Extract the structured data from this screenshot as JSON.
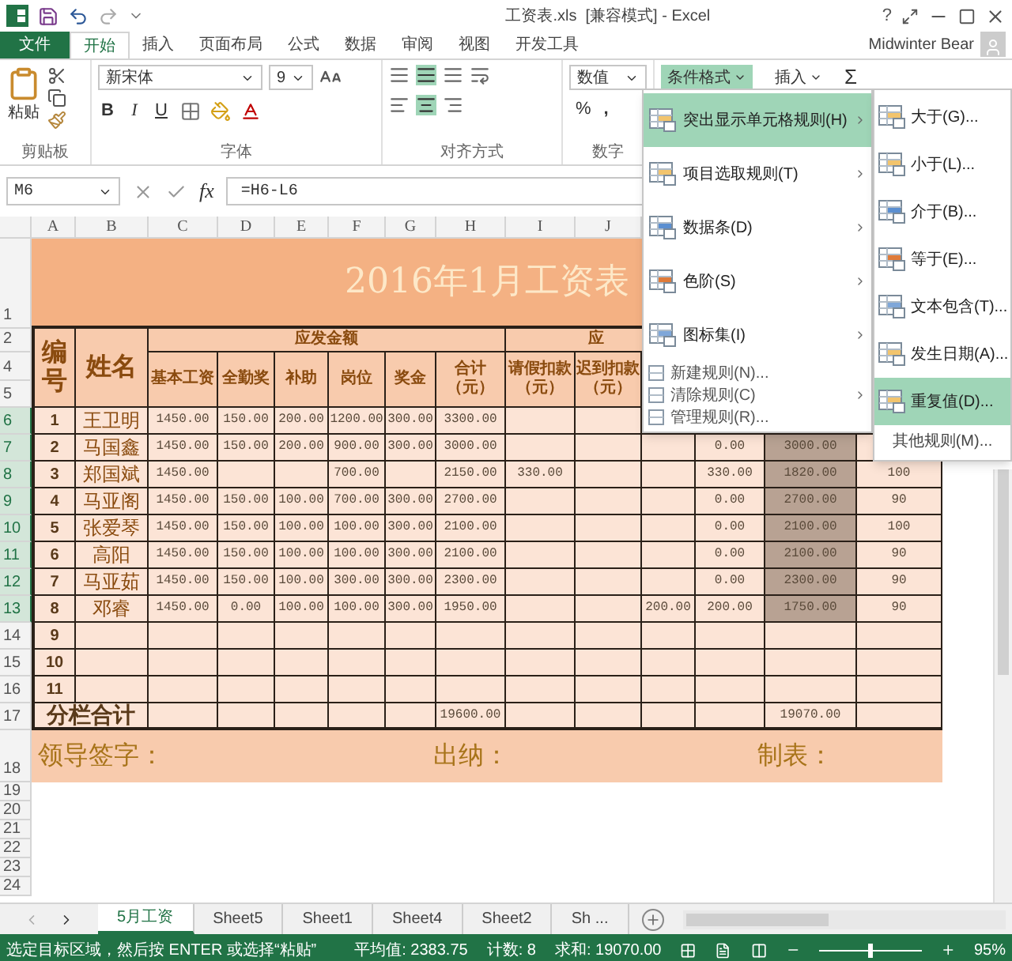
{
  "title_bar": {
    "title": "工资表.xls  [兼容模式] - Excel",
    "help": "?",
    "user": "Midwinter Bear"
  },
  "ribbon_tabs": [
    {
      "label": "文件",
      "kind": "file",
      "selected": false
    },
    {
      "label": "开始",
      "kind": "tab",
      "selected": true
    },
    {
      "label": "插入",
      "kind": "tab",
      "selected": false
    },
    {
      "label": "页面布局",
      "kind": "tab",
      "selected": false
    },
    {
      "label": "公式",
      "kind": "tab",
      "selected": false
    },
    {
      "label": "数据",
      "kind": "tab",
      "selected": false
    },
    {
      "label": "审阅",
      "kind": "tab",
      "selected": false
    },
    {
      "label": "视图",
      "kind": "tab",
      "selected": false
    },
    {
      "label": "开发工具",
      "kind": "tab",
      "selected": false
    }
  ],
  "ribbon": {
    "paste": "粘贴",
    "font_name": "新宋体",
    "font_size": "9",
    "bold": "B",
    "italic": "I",
    "underline": "U",
    "number_format": "数值",
    "percent": "%",
    "comma": ",",
    "groups": [
      "剪贴板",
      "字体",
      "对齐方式",
      "数字"
    ],
    "commands": [
      {
        "label": "条件格式",
        "active": true
      },
      {
        "label": "插入",
        "active": false
      }
    ],
    "sum": "Σ"
  },
  "formula_bar": {
    "name_box": "M6",
    "fx": "fx",
    "formula": "=H6-L6"
  },
  "sheet": {
    "columns": [
      {
        "label": "A"
      },
      {
        "label": "B"
      },
      {
        "label": "C"
      },
      {
        "label": "D"
      },
      {
        "label": "E"
      },
      {
        "label": "F"
      },
      {
        "label": "G"
      },
      {
        "label": "H"
      },
      {
        "label": "I"
      },
      {
        "label": "J"
      }
    ],
    "header_row_numbers": [
      "1",
      "2",
      "4",
      "5"
    ],
    "title": "2016年1月工资表",
    "headers": {
      "number": "编号",
      "name": "姓名",
      "gross_group": "应发金额",
      "deduct_group": "应",
      "gross_columns": [
        "基本工资",
        "全勤奖",
        "补助",
        "岗位",
        "奖金",
        "合计（元）"
      ],
      "deduct_columns": [
        "请假扣款（元）",
        "迟到扣款（元）"
      ]
    },
    "rows": [
      {
        "row": "6",
        "selected": true,
        "no": "1",
        "name": "王卫明",
        "cells": {
          "C": "1450.00",
          "D": "150.00",
          "E": "200.00",
          "F": "1200.00",
          "G": "300.00",
          "H": "3300.00"
        }
      },
      {
        "row": "7",
        "selected": true,
        "no": "2",
        "name": "马国鑫",
        "cells": {
          "C": "1450.00",
          "D": "150.00",
          "E": "200.00",
          "F": "900.00",
          "G": "300.00",
          "H": "3000.00",
          "L": "0.00",
          "M": "3000.00"
        }
      },
      {
        "row": "8",
        "selected": true,
        "no": "3",
        "name": "郑国斌",
        "cells": {
          "C": "1450.00",
          "F": "700.00",
          "H": "2150.00",
          "I": "330.00",
          "L": "330.00",
          "M": "1820.00",
          "N": "100"
        }
      },
      {
        "row": "9",
        "selected": true,
        "no": "4",
        "name": "马亚阁",
        "cells": {
          "C": "1450.00",
          "D": "150.00",
          "E": "100.00",
          "F": "700.00",
          "G": "300.00",
          "H": "2700.00",
          "L": "0.00",
          "M": "2700.00",
          "N": "90"
        }
      },
      {
        "row": "10",
        "selected": true,
        "no": "5",
        "name": "张爱琴",
        "cells": {
          "C": "1450.00",
          "D": "150.00",
          "E": "100.00",
          "F": "100.00",
          "G": "300.00",
          "H": "2100.00",
          "L": "0.00",
          "M": "2100.00",
          "N": "100"
        }
      },
      {
        "row": "11",
        "selected": true,
        "no": "6",
        "name": "高阳",
        "cells": {
          "C": "1450.00",
          "D": "150.00",
          "E": "100.00",
          "F": "100.00",
          "G": "300.00",
          "H": "2100.00",
          "L": "0.00",
          "M": "2100.00",
          "N": "90"
        }
      },
      {
        "row": "12",
        "selected": true,
        "no": "7",
        "name": "马亚茹",
        "cells": {
          "C": "1450.00",
          "D": "150.00",
          "E": "100.00",
          "F": "300.00",
          "G": "300.00",
          "H": "2300.00",
          "L": "0.00",
          "M": "2300.00",
          "N": "90"
        }
      },
      {
        "row": "13",
        "selected": true,
        "no": "8",
        "name": "邓睿",
        "cells": {
          "C": "1450.00",
          "D": "0.00",
          "E": "100.00",
          "F": "100.00",
          "G": "300.00",
          "H": "1950.00",
          "K": "200.00",
          "L": "200.00",
          "M": "1750.00",
          "N": "90"
        }
      },
      {
        "row": "14",
        "selected": false,
        "no": "9"
      },
      {
        "row": "15",
        "selected": false,
        "no": "10"
      },
      {
        "row": "16",
        "selected": false,
        "no": "11"
      }
    ],
    "total": {
      "row": "17",
      "label": "分栏合计",
      "cells": {
        "H": "19600.00",
        "M": "19070.00"
      }
    },
    "signatures": {
      "row": "18",
      "items": [
        "领导签字：",
        "出纳：",
        "制表："
      ]
    },
    "blank_rows": [
      "19",
      "20",
      "21",
      "22",
      "23",
      "24"
    ]
  },
  "menu": {
    "items": [
      {
        "label": "突出显示单元格规则(H)",
        "kind": "large",
        "selected": true,
        "submenu": true
      },
      {
        "label": "项目选取规则(T)",
        "kind": "large",
        "selected": false,
        "submenu": true
      },
      {
        "label": "数据条(D)",
        "kind": "large",
        "selected": false,
        "submenu": true
      },
      {
        "label": "色阶(S)",
        "kind": "large",
        "selected": false,
        "submenu": true
      },
      {
        "label": "图标集(I)",
        "kind": "large",
        "selected": false,
        "submenu": true
      },
      {
        "label": "新建规则(N)...",
        "kind": "small",
        "selected": false,
        "submenu": false
      },
      {
        "label": "清除规则(C)",
        "kind": "small",
        "selected": false,
        "submenu": true
      },
      {
        "label": "管理规则(R)...",
        "kind": "small",
        "selected": false,
        "submenu": false
      }
    ]
  },
  "submenu": {
    "items": [
      {
        "label": "大于(G)...",
        "kind": "large",
        "selected": false
      },
      {
        "label": "小于(L)...",
        "kind": "large",
        "selected": false
      },
      {
        "label": "介于(B)...",
        "kind": "large",
        "selected": false
      },
      {
        "label": "等于(E)...",
        "kind": "large",
        "selected": false
      },
      {
        "label": "文本包含(T)...",
        "kind": "large",
        "selected": false
      },
      {
        "label": "发生日期(A)...",
        "kind": "large",
        "selected": false
      },
      {
        "label": "重复值(D)...",
        "kind": "large",
        "selected": true
      },
      {
        "label": "其他规则(M)...",
        "kind": "text",
        "selected": false
      }
    ]
  },
  "sheet_tabs": [
    {
      "label": "5月工资",
      "selected": true
    },
    {
      "label": "Sheet5",
      "selected": false
    },
    {
      "label": "Sheet1",
      "selected": false
    },
    {
      "label": "Sheet4",
      "selected": false
    },
    {
      "label": "Sheet2",
      "selected": false
    },
    {
      "label": "Sh ...",
      "selected": false
    }
  ],
  "status_bar": {
    "message": "选定目标区域，然后按 ENTER 或选择“粘贴”",
    "average": "平均值: 2383.75",
    "count": "计数: 8",
    "sum": "求和: 19070.00",
    "zoom": "95%",
    "zoom_slider": {
      "level": 0.5
    }
  }
}
